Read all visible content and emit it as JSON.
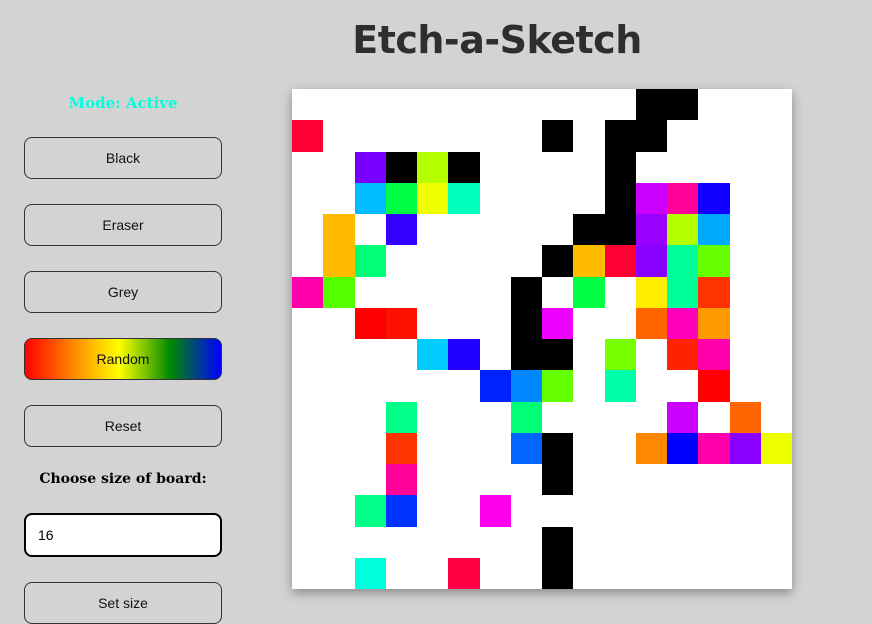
{
  "app": {
    "title": "Etch-a-Sketch"
  },
  "sidebar": {
    "mode_label": "Mode: Active",
    "buttons": {
      "black": "Black",
      "eraser": "Eraser",
      "grey": "Grey",
      "random": "Random",
      "reset": "Reset",
      "set_size": "Set size"
    },
    "size_label": "Choose size of board:",
    "size_value": "16"
  },
  "board": {
    "size": 16,
    "background": "#ffffff",
    "cells": [
      [
        null,
        null,
        null,
        null,
        null,
        null,
        null,
        null,
        null,
        null,
        null,
        "#000000",
        "#000000",
        null,
        null,
        null
      ],
      [
        "#ff0033",
        null,
        null,
        null,
        null,
        null,
        null,
        null,
        "#000000",
        null,
        "#000000",
        "#000000",
        null,
        null,
        null,
        null
      ],
      [
        null,
        null,
        "#7700ff",
        "#000000",
        "#b3ff00",
        "#000000",
        null,
        null,
        null,
        null,
        "#000000",
        null,
        null,
        null,
        null,
        null
      ],
      [
        null,
        null,
        "#00bbff",
        "#00ff44",
        "#eeff00",
        "#00ffbb",
        null,
        null,
        null,
        null,
        "#000000",
        "#cc00ff",
        "#ff0099",
        "#1100ff",
        null,
        null
      ],
      [
        null,
        "#ffbb00",
        null,
        "#3300ff",
        null,
        null,
        null,
        null,
        null,
        "#000000",
        "#000000",
        "#9900ff",
        "#b3ff00",
        "#00aaff",
        null,
        null
      ],
      [
        null,
        "#ffbb00",
        "#00ff77",
        null,
        null,
        null,
        null,
        null,
        "#000000",
        "#ffbb00",
        "#ff0033",
        "#8800ff",
        "#00ff99",
        "#66ff00",
        null,
        null
      ],
      [
        "#ff00aa",
        "#55ff00",
        null,
        null,
        null,
        null,
        null,
        "#000000",
        null,
        "#00ff44",
        null,
        "#ffee00",
        "#00ff99",
        "#ff3300",
        null,
        null
      ],
      [
        null,
        null,
        "#ff0000",
        "#ff1100",
        null,
        null,
        null,
        "#000000",
        "#ee00ff",
        null,
        null,
        "#ff6600",
        "#ff00bb",
        "#ff9900",
        null,
        null
      ],
      [
        null,
        null,
        null,
        null,
        "#00ccff",
        "#2200ff",
        null,
        "#000000",
        "#000000",
        null,
        "#77ff00",
        null,
        "#ff2200",
        "#ff00aa",
        null,
        null
      ],
      [
        null,
        null,
        null,
        null,
        null,
        null,
        "#0022ff",
        "#0088ff",
        "#66ff00",
        null,
        "#00ffaa",
        null,
        null,
        "#ff0000",
        null,
        null
      ],
      [
        null,
        null,
        null,
        "#00ff88",
        null,
        null,
        null,
        "#00ff77",
        null,
        null,
        null,
        null,
        "#cc00ff",
        null,
        "#ff6600",
        null
      ],
      [
        null,
        null,
        null,
        "#ff3300",
        null,
        null,
        null,
        "#0066ff",
        "#000000",
        null,
        null,
        "#ff8800",
        "#0000ff",
        "#ff00aa",
        "#8800ff",
        "#eeff00"
      ],
      [
        null,
        null,
        null,
        "#ff0099",
        null,
        null,
        null,
        null,
        "#000000",
        null,
        null,
        null,
        null,
        null,
        null,
        null
      ],
      [
        null,
        null,
        "#00ff88",
        "#0033ff",
        null,
        null,
        "#ff00ee",
        null,
        null,
        null,
        null,
        null,
        null,
        null,
        null,
        null
      ],
      [
        null,
        null,
        null,
        null,
        null,
        null,
        null,
        null,
        "#000000",
        null,
        null,
        null,
        null,
        null,
        null,
        null
      ],
      [
        null,
        null,
        "#00ffdd",
        null,
        null,
        "#ff0044",
        null,
        null,
        "#000000",
        null,
        null,
        null,
        null,
        null,
        null,
        null
      ]
    ]
  },
  "colors": {
    "page_background": "#d3d3d3",
    "mode_label": "#00ffdd",
    "title": "#2e2e2e"
  }
}
